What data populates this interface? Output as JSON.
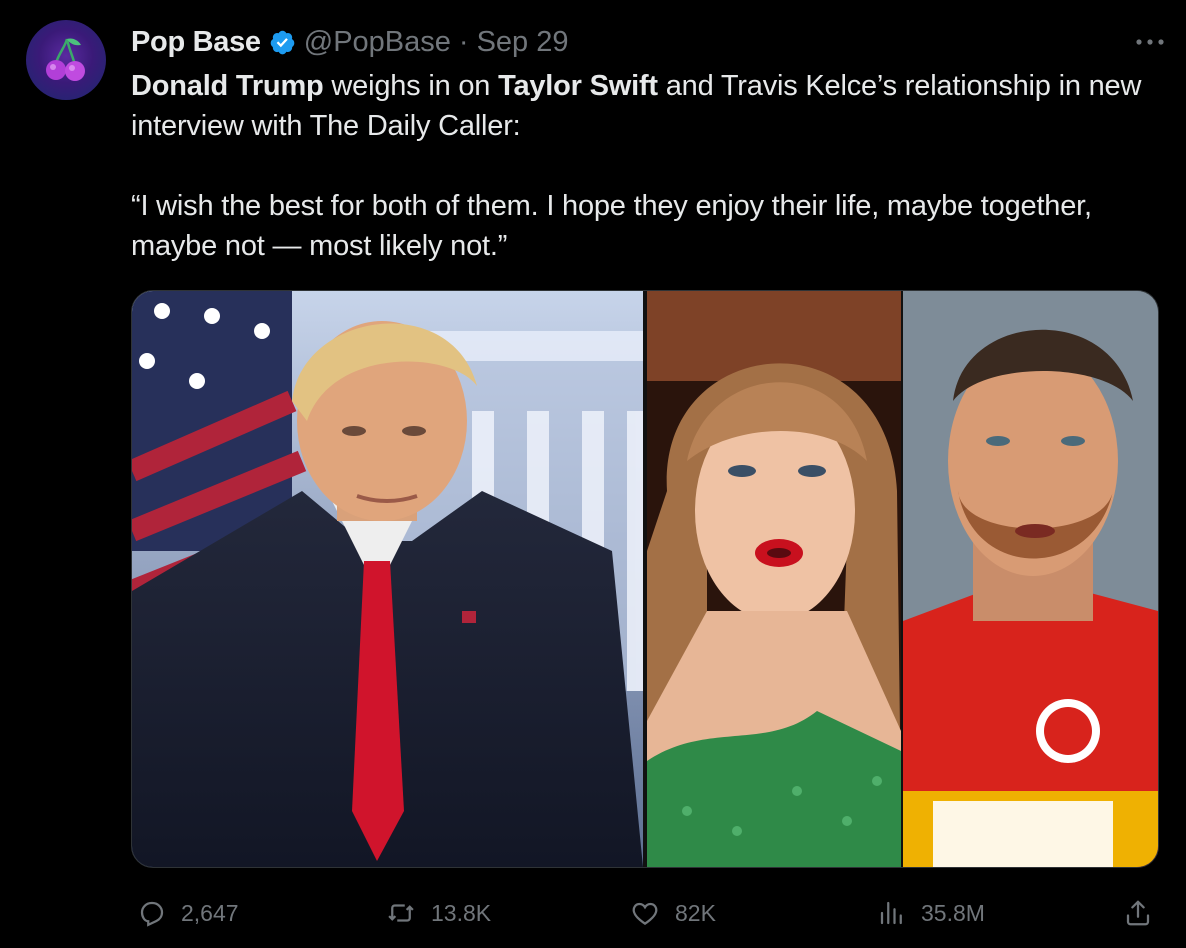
{
  "account": {
    "display_name": "Pop Base",
    "handle": "@PopBase",
    "separator": "·",
    "date": "Sep 29",
    "verified_color": "#1d9bf0",
    "avatar_icon": "cherries-icon"
  },
  "tweet": {
    "line1_bold_1": "Donald Trump",
    "line1_text_1": " weighs in on ",
    "line1_bold_2": "Taylor Swift",
    "line1_text_2": " and Travis Kelce’s relationship in new interview with The Daily Caller:",
    "quote": "“I wish the best for both of them. I hope they enjoy their life, maybe together, maybe not — most likely not.”"
  },
  "media": {
    "panels": [
      {
        "subject": "Donald Trump portrait with US flag and White House"
      },
      {
        "subject": "Taylor Swift close-up"
      },
      {
        "subject": "Travis Kelce in Chiefs jersey"
      }
    ]
  },
  "actions": {
    "replies": "2,647",
    "reposts": "13.8K",
    "likes": "82K",
    "views": "35.8M"
  },
  "colors": {
    "background": "#000000",
    "text": "#e7e9ea",
    "muted": "#71767b",
    "accent": "#1d9bf0"
  }
}
